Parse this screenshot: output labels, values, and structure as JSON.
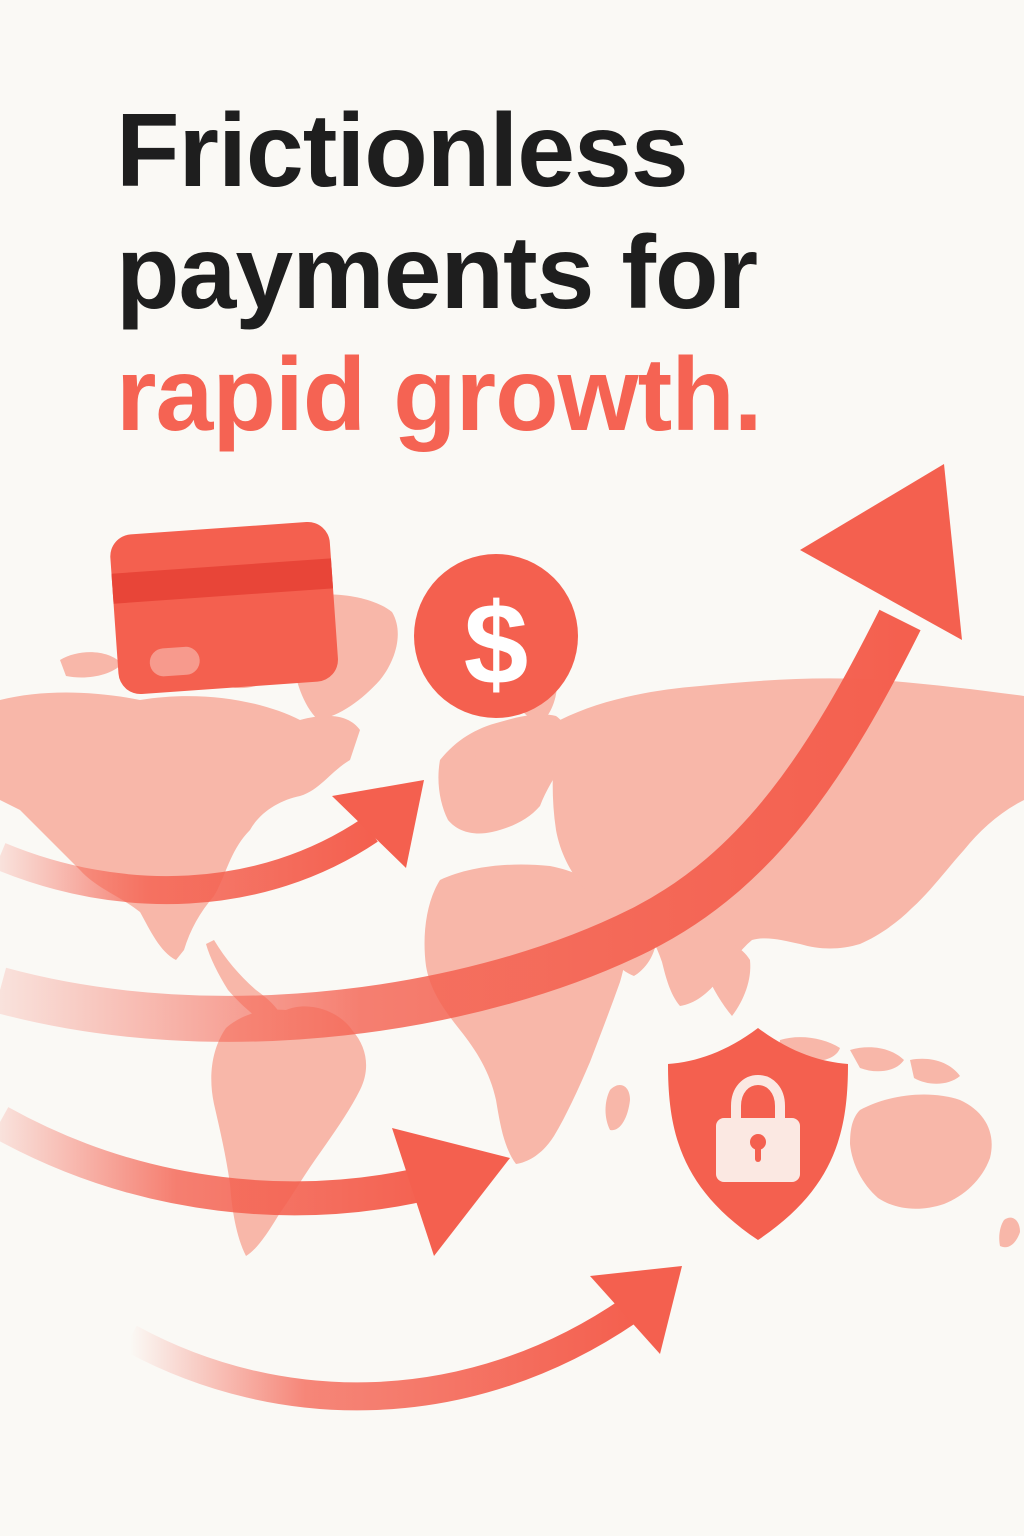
{
  "headline": {
    "line1": "Frictionless",
    "line2": "payments for",
    "line3": "rapid growth."
  },
  "colors": {
    "background": "#faf9f5",
    "text": "#1e1e1e",
    "accent": "#f56353",
    "map": "#f8b7a9",
    "arrow": "#f4604f"
  },
  "icons": [
    "credit-card-icon",
    "dollar-coin-icon",
    "shield-lock-icon",
    "world-map",
    "growth-arrow-icon"
  ],
  "coin_symbol": "$"
}
